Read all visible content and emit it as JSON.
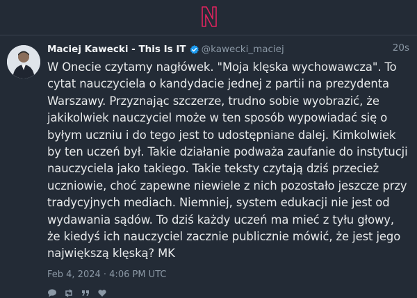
{
  "tweet": {
    "display_name": "Maciej Kawecki - This Is IT",
    "handle": "@kawecki_maciej",
    "relative_time": "20s",
    "text": "W Onecie czytamy nagłówek. \"Moja klęska wychowawcza\". To cytat nauczyciela o kandydacie jednej z partii na prezydenta Warszawy. Przyznając szczerze, trudno sobie wyobrazić, że jakikolwiek nauczyciel może w ten sposób wypowiadać się o byłym uczniu i do tego jest to udostępniane dalej. Kimkolwiek by ten uczeń był. Takie działanie podważa zaufanie do instytucji nauczyciela jako takiego. Takie teksty czytają dziś przecież uczniowie, choć zapewne niewiele z nich pozostało jeszcze przy tradycyjnych mediach. Niemniej, system edukacji nie jest od wydawania sądów. To dziś każdy uczeń ma mieć z tyłu głowy, że kiedyś ich nauczyciel zacznie publicznie mówić, że jest jego największą klęską? MK",
    "timestamp": "Feb 4, 2024 · 4:06 PM UTC"
  },
  "icons": {
    "app_logo": "n-logo-icon",
    "verified": "verified-badge-icon",
    "actions": [
      "reply-icon",
      "retweet-icon",
      "quote-icon",
      "like-icon"
    ]
  },
  "colors": {
    "background": "#232b36",
    "accent_logo": "#e0245e",
    "verified": "#1d9bf0",
    "muted_text": "#8b98a5"
  }
}
